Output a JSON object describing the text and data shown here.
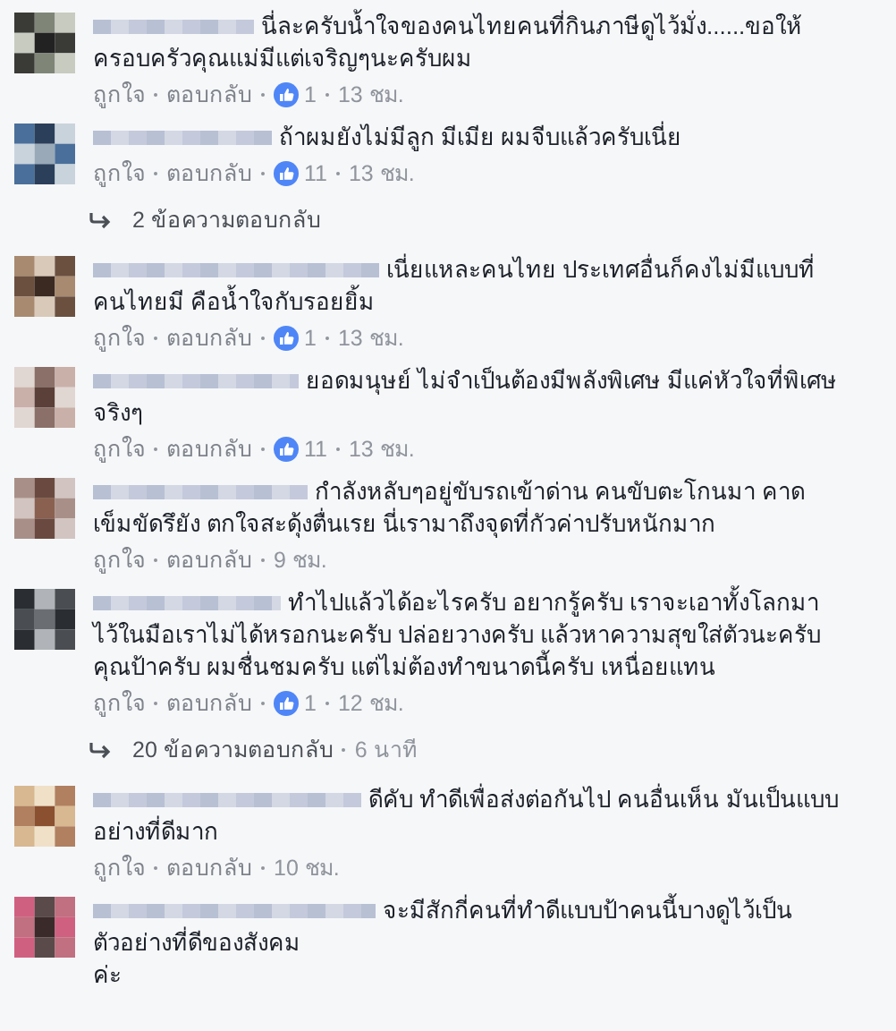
{
  "feed": [
    {
      "kind": "comment",
      "text": "นี่ละครับน้ำใจของคนไทยคนที่กินภาษีดูไว้มั่ง......ขอให้ครอบครัวคุณแม่มีแต่เจริญๆนะครับผม",
      "like_action": "ถูกใจ",
      "reply_action": "ตอบกลับ",
      "like_count": "1",
      "time": "13 ชม."
    },
    {
      "kind": "comment",
      "text": "ถ้าผมยังไม่มีลูก มีเมีย ผมจีบแล้วครับเนี่ย",
      "like_action": "ถูกใจ",
      "reply_action": "ตอบกลับ",
      "like_count": "11",
      "time": "13 ชม."
    },
    {
      "kind": "replies",
      "label": "2 ข้อความตอบกลับ"
    },
    {
      "kind": "comment",
      "text": "เนี่ยแหละคนไทย ประเทศอื่นก็คงไม่มีแบบที่คนไทยมี คือน้ำใจกับรอยยิ้ม",
      "like_action": "ถูกใจ",
      "reply_action": "ตอบกลับ",
      "like_count": "1",
      "time": "13 ชม."
    },
    {
      "kind": "comment",
      "text": "ยอดมนุษย์ ไม่จำเป็นต้องมีพลังพิเศษ มีแค่หัวใจที่พิเศษจริงๆ",
      "like_action": "ถูกใจ",
      "reply_action": "ตอบกลับ",
      "like_count": "11",
      "time": "13 ชม."
    },
    {
      "kind": "comment",
      "text": "กำลังหลับๆอยู่ขับรถเข้าด่าน คนขับตะโกนมา คาดเข็มขัดรึยัง ตกใจสะดุ้งตื่นเรย นี่เรามาถึงจุดที่กัวค่าปรับหนักมาก",
      "like_action": "ถูกใจ",
      "reply_action": "ตอบกลับ",
      "time": "9 ชม."
    },
    {
      "kind": "comment",
      "text": "ทำไปแล้วได้อะไรครับ อยากรู้ครับ เราจะเอาทั้งโลกมาไว้ในมือเราไม่ได้หรอกนะครับ ปล่อยวางครับ แล้วหาความสุขใส่ตัวนะครับ คุณป้าครับ ผมชื่นชมครับ แต่ไม่ต้องทำขนาดนี้ครับ เหนื่อยแทน",
      "like_action": "ถูกใจ",
      "reply_action": "ตอบกลับ",
      "like_count": "1",
      "time": "12 ชม."
    },
    {
      "kind": "replies",
      "label": "20 ข้อความตอบกลับ",
      "time": "6 นาที"
    },
    {
      "kind": "comment",
      "text": "ดีคับ ทำดีเพื่อส่งต่อกันไป คนอื่นเห็น มันเป็นแบบอย่างที่ดีมาก",
      "like_action": "ถูกใจ",
      "reply_action": "ตอบกลับ",
      "time": "10 ชม."
    },
    {
      "kind": "comment",
      "text": "จะมีสักกี่คนที่ทำดีแบบป้าคนนี้บางดูไว้เป็นตัวอย่างที่ดีของสังคม\nค่ะ"
    }
  ]
}
